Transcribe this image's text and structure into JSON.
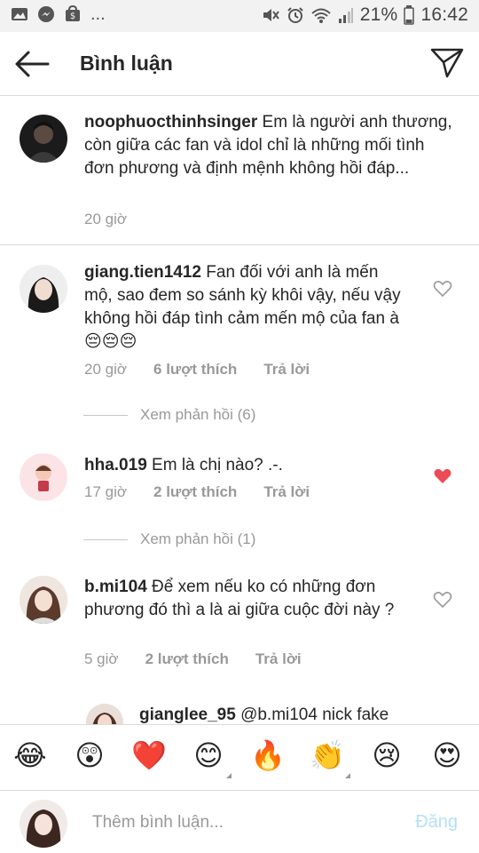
{
  "status_bar": {
    "battery": "21%",
    "time": "16:42",
    "more": "..."
  },
  "header": {
    "title": "Bình luận",
    "back_icon": "arrow-left-icon",
    "share_icon": "paper-plane-icon"
  },
  "caption": {
    "username": "noophuocthinhsinger",
    "text": "Em là người anh thương, còn giữa các fan và idol chỉ là những mối tình đơn phương và định mệnh không hồi đáp...",
    "time": "20 giờ"
  },
  "comments": [
    {
      "username": "giang.tien1412",
      "text": "Fan đối với anh là mến mộ, sao đem so sánh kỳ khôi vậy, nếu vậy không hồi đáp tình cảm mến mộ của fan à 😔😔😔",
      "time": "20 giờ",
      "likes": "6 lượt thích",
      "reply": "Trả lời",
      "view_replies": "Xem phản hồi (6)",
      "liked": false
    },
    {
      "username": "hha.019",
      "text": "Em là chị nào? .-.",
      "time": "17 giờ",
      "likes": "2 lượt thích",
      "reply": "Trả lời",
      "view_replies": "Xem phản hồi (1)",
      "liked": true
    },
    {
      "username": "b.mi104",
      "text": "Để xem nếu ko có những đơn phương đó thì a là ai giữa cuộc đời này ?",
      "time": "5 giờ",
      "likes": "2 lượt thích",
      "reply": "Trả lời",
      "liked": false
    }
  ],
  "partial_reply": {
    "username": "gianglee_95",
    "text": "@b.mi104 nick fake"
  },
  "emoji_bar": [
    "😂",
    "😲",
    "❤️",
    "😊",
    "🔥",
    "👏",
    "😢",
    "😍"
  ],
  "comment_input": {
    "placeholder": "Thêm bình luận...",
    "post_label": "Đăng"
  },
  "colors": {
    "liked_heart": "#ed4956",
    "post_disabled": "#b2dffc",
    "meta_grey": "#999999"
  }
}
